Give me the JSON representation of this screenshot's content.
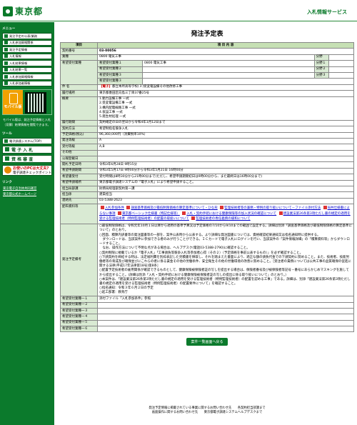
{
  "header": {
    "logo": "東京都",
    "system_name": "入札情報サービス"
  },
  "sidebar": {
    "menu_title": "メニュー",
    "items": [
      "発注予定の公表/業務",
      "入札参加資格関係",
      "発注予定情報",
      "入札情報",
      "入札結果情報",
      "入札結果一覧",
      "入札参加資格情報",
      "入札参加者情報"
    ],
    "mobile_badge": "モバイル版",
    "mobile_note": "モバイル版は、発注予定情報と入札（見積）結果情報を閲覧できます。",
    "tools_title": "ツール",
    "tools": [
      "電子調達システム(TOP)",
      "電 子 入 札",
      "資 格 審 査"
    ],
    "check_line1": "お使いのPCは大丈夫?",
    "check_line2": "電子調達チェックポイント",
    "links_title": "リンク",
    "links": [
      "東京電子自治体共同運営",
      "東京都公式ホームページ"
    ]
  },
  "main": {
    "title": "発注予定表",
    "col_item": "項目",
    "col_content": "項 目 内 容",
    "contract_no_label": "契約番号",
    "contract_no": "03-00056",
    "industry_label": "業種",
    "industry": "0800 電気工事",
    "desired_label": "希望受付業種",
    "desired_rows": [
      {
        "label": "希望受付業種１",
        "value": "0800 電気工事",
        "sub_label": "分野",
        "sub_value": ""
      },
      {
        "label": "希望受付業種２",
        "value": "",
        "sub_label": "分野１",
        "sub_value": ""
      },
      {
        "label": "希望受付業種３",
        "value": "",
        "sub_label": "分野２",
        "sub_value": ""
      },
      {
        "label": "希望受付業種３",
        "value": "",
        "sub_label": "分野３",
        "sub_value": ""
      }
    ],
    "subject_label": "件 名",
    "subject_tag": "【電子】",
    "subject": "都立本所高等学校(３)受変電設備その他改修工事",
    "place_label": "履行場所",
    "place": "東京都墨田区向島三丁目37番25号",
    "summary_label": "概要",
    "summary_lines": [
      "1.動力設備工事 一式",
      "2.受変電設備工事 一式",
      "3.構内配電線路工事 一式",
      "4.仮設工事 一式",
      "5.発生材処理 一式"
    ],
    "period_label": "履行期間",
    "period": "契約確定の日の翌日から令和4年1月12日まで",
    "method_label": "契約方法",
    "method": "希望制指名競争入札",
    "price_label": "予定価格(税込)",
    "price": "96,360,000円（消費税率10%）",
    "grade_label": "発注等級",
    "grade": "A",
    "accept_grade_label": "受付等級",
    "accept_grade": "A,B",
    "other_label": "その他",
    "other": "",
    "notice_date_label": "公報登載日",
    "notice_date": "",
    "open_date_label": "開札予定日時",
    "open_date": "令和3年6月28日 9時15分",
    "apply_period_label": "希望申請期間",
    "apply_period": "令和3年5月17日 9時00分から令和3年5月21日 16時00分",
    "apply_accept_label": "希望書受付",
    "apply_accept": "受付時間は8時30分から21時00分まで(ただし、希望申請期間初日は9時00分から、また最終日は16時00分まで)",
    "apply_method_label": "希望申請場所",
    "apply_method": "東京都電子調達システムの「電子入札」により希望申請すること。",
    "office_label": "担当局部課",
    "office": "財務局経理部契約第一課",
    "person_label": "担当係",
    "person": "建築担当",
    "contact_label": "連絡先",
    "contact": "03-5388-2623",
    "docs_label": "配布資料等",
    "docs": [
      "入札参加条件",
      "調査基準価格及び最低制限価格の算定基準について・ひな形",
      "監理技術者等の兼務・特例の取り扱いについて－ファイル添付方法",
      "局共仕様書によらない事項",
      "東京都ベーシック仕様書（特記仕様等）",
      "入札・契約手続における健康保険等の加入状況の確認について",
      "建設業法第26条第3項ただし書の規定の適用を受ける監理技術者（特例監理技術者）の配置の取扱いについて",
      "監理技術者の専任義務の緩和について"
    ],
    "notes_label": "発注予定備考",
    "notes": [
      "○最低制限価格は、令和元年10月１日以降から適用の基準予算又は予定価格の7/10から9/10までの範囲で設定する。詳細は別添「調査基準価格及び最低制限価格の算定基準について」のとおり。",
      "○回面、積算内訳書等の発注図書等の一部を、案件公表時から公表する。より詳細な発注図書については、資格確認結果通知又は指名通知時に提供する。",
      "　ダウンロードは、当該案件に参加できる者のみが行うことができる。ＩＣカードで電子入札にログインを行い、当該案件の「案件情報詳細」の「積算資料等」からダウンロードすること。",
      "　なお、操作方法について不明な点がある場合は、ヘルプデスク(電話03-5388-2790)に確認すること。",
      "○契約制限に規載ているか「電子入札」「工事請負等競争入札等参加者心得（その２）（予定価格を事前公表するもの）」を必ず確認すること。",
      "○下請契約を締結する時は、法定福利費を別枠表記した見積書を徴取し、それを踏まえた書面により、適正な額の請負代金での下請契約に努めること。また、技術者、技能労働者等の育成及び確保並びにこれらの者に係る賃金その他の労働条件、安全衛生その他の労働環境の改善に努めること。［受注者の責務については公共工事の品質確保の促進に関する法律(平成17年法律第18号)第8条］",
      "○配置予定技術者の雇用関係が確認できるものとして、健康保険被保険者証の写しを提出する場合は、保険者番号及び被保険者等記号・番号にあらかじめマスキングを施してから提出すること。(詳細は別添「入札・契約手続における健康保険被保険者証の写しの提出に係る取り扱いについて」のとおり。）",
      "○本案件は、「建設業法第26条第3項ただし書の規定の適用を受ける監理技術者（特例監理技術者）の配置を認める工事」である。詳細は、別添「建設業法第26条第3項ただし書の規定の適用を受ける監理技術者（特例監理技術者）の配置要件について」を確認すること。",
      "○指名通知：令和３年６月２日の予定",
      "○起工部署：教育庁"
    ],
    "attach_rows": [
      {
        "label": "希望受付業種一１",
        "value": "添付ファイル「入札参加条件」参照"
      },
      {
        "label": "希望受付業種一２",
        "value": ""
      },
      {
        "label": "希望受付業種一３",
        "value": ""
      },
      {
        "label": "希望受付業種一４",
        "value": ""
      },
      {
        "label": "希望受付業種一５",
        "value": ""
      },
      {
        "label": "希望受付業種一６",
        "value": ""
      }
    ],
    "back_button": "案件一覧画面へ戻る"
  },
  "footer": {
    "line1": "発注予定情報に掲載されている事業に関するお問い合わせ先　　各契約担当部課まで",
    "line2": "画面操作に関するお問い合わせ先　　東京都電子調達システムヘルプデスクまで"
  },
  "colors": {
    "brand_green": "#0b7a2c",
    "header_cell": "#c6e0b4",
    "label_cell": "#d9ead3",
    "tag_red": "#cc0000"
  }
}
